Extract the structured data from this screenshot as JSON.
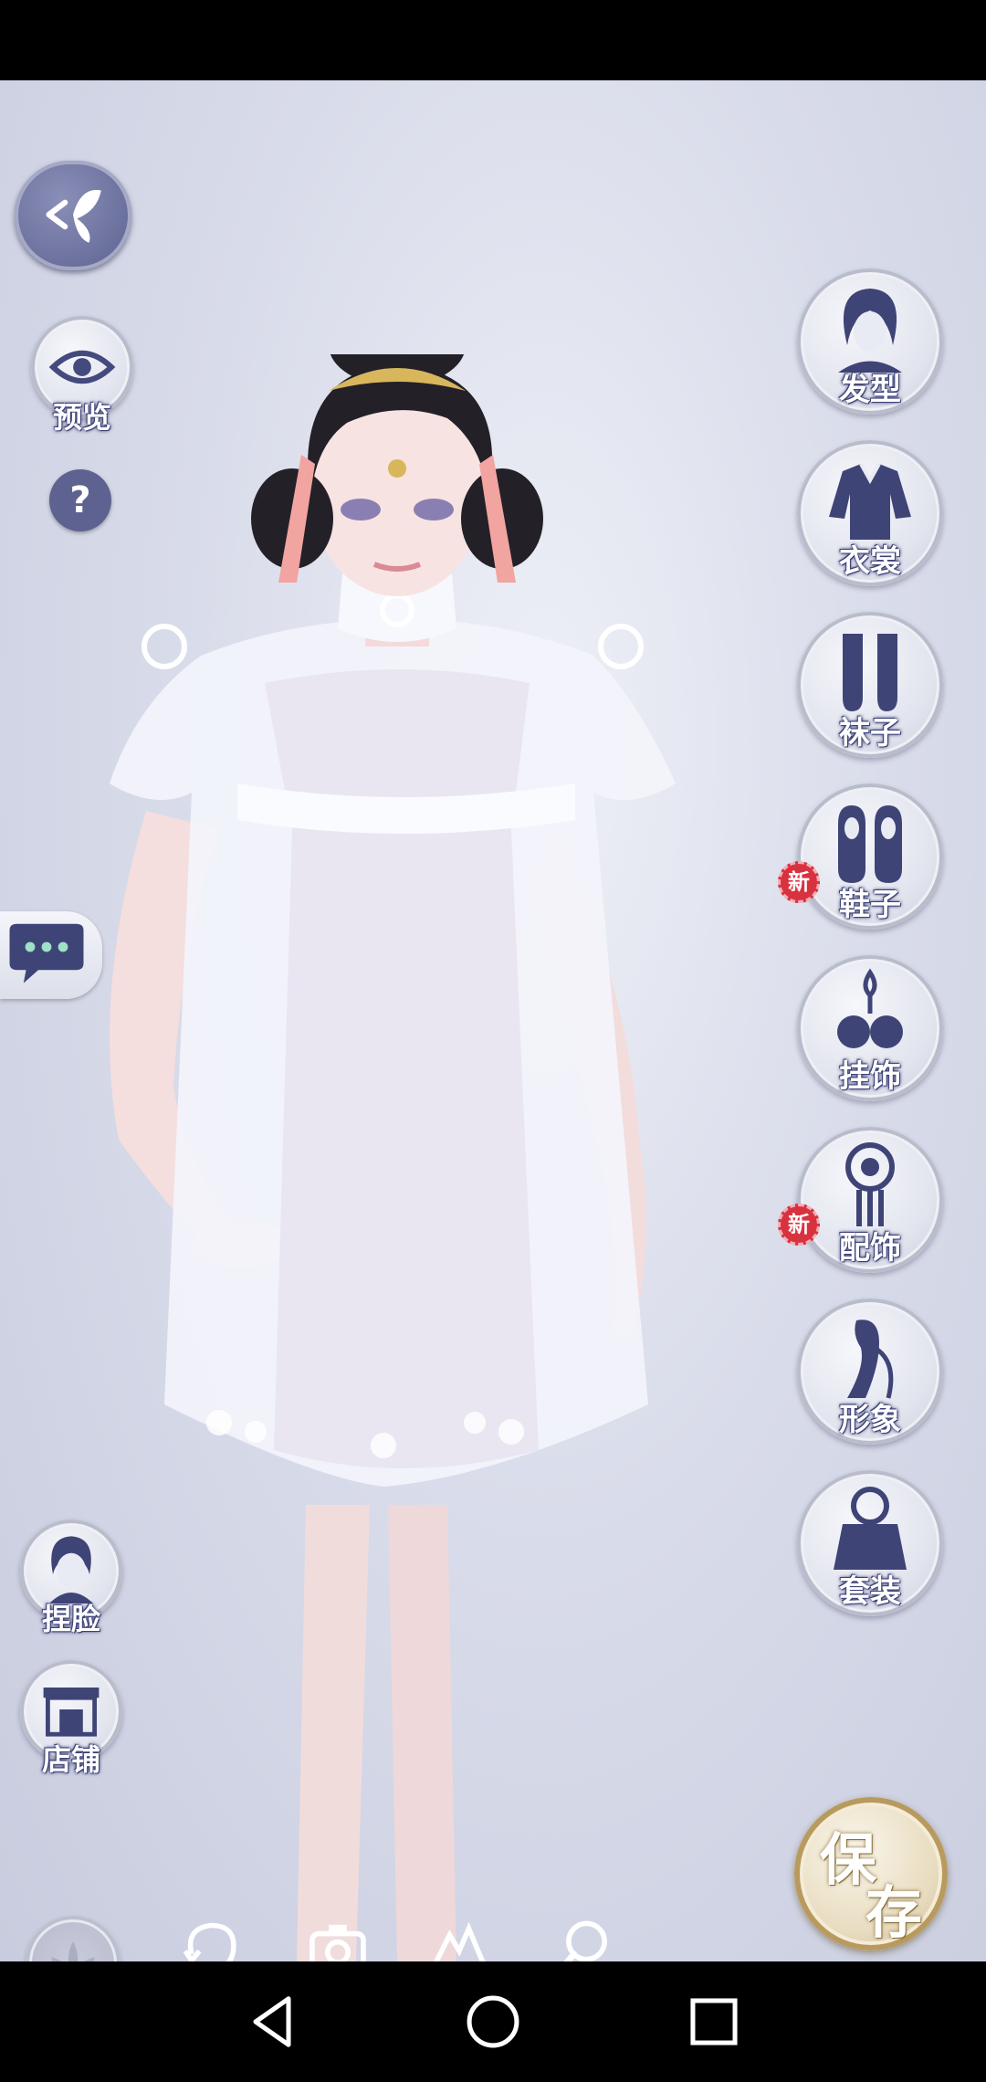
{
  "sidebar_left": {
    "preview_label": "预览",
    "face_label": "捏脸",
    "shop_label": "店铺"
  },
  "categories": [
    {
      "label": "发型",
      "icon": "hairstyle-icon",
      "new": false
    },
    {
      "label": "衣裳",
      "icon": "clothing-icon",
      "new": false
    },
    {
      "label": "袜子",
      "icon": "socks-icon",
      "new": false
    },
    {
      "label": "鞋子",
      "icon": "shoes-icon",
      "new": true
    },
    {
      "label": "挂饰",
      "icon": "pendant-icon",
      "new": false
    },
    {
      "label": "配饰",
      "icon": "accessory-icon",
      "new": true
    },
    {
      "label": "形象",
      "icon": "appearance-icon",
      "new": false
    },
    {
      "label": "套装",
      "icon": "outfit-icon",
      "new": false
    }
  ],
  "badge_new": "新",
  "bottom_bar": {
    "restore_label": "恢复",
    "photo_label": "拍照",
    "scene_label": "场景",
    "search_label": "搜索"
  },
  "save": {
    "line1": "保",
    "line2": "存"
  },
  "colors": {
    "accent_navy": "#3d4277",
    "badge_red": "#d9323f",
    "save_gold": "#b89a5e"
  }
}
